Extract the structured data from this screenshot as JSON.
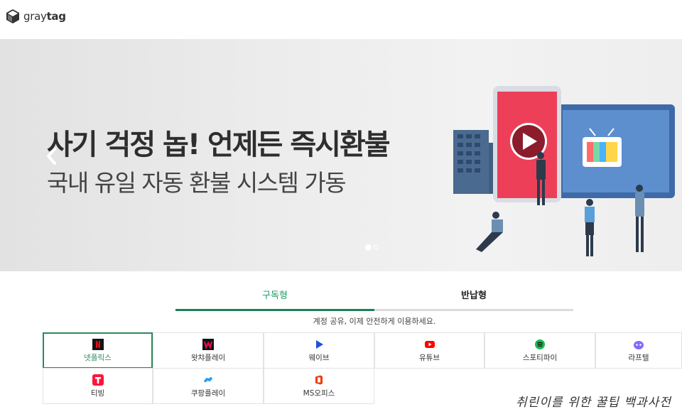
{
  "brand": {
    "logo_text_light": "gray",
    "logo_text_bold": "tag"
  },
  "banner": {
    "title": "사기 걱정 놉! 언제든 즉시환불",
    "subtitle": "국내 유일 자동 환불 시스템 가동",
    "slides_total": 2,
    "slide_active": 1
  },
  "tabs": [
    {
      "label": "구독형",
      "active": true
    },
    {
      "label": "반납형",
      "active": false
    }
  ],
  "notice": "계정 공유, 이제 안전하게 이용하세요.",
  "services": [
    {
      "name": "넷플릭스",
      "icon": "netflix-icon",
      "color": "#e50914",
      "active": true
    },
    {
      "name": "왓챠플레이",
      "icon": "watcha-icon",
      "color": "#ff0558",
      "active": false
    },
    {
      "name": "웨이브",
      "icon": "wavve-icon",
      "color": "#1f4fe0",
      "active": false
    },
    {
      "name": "유튜브",
      "icon": "youtube-icon",
      "color": "#ff0000",
      "active": false
    },
    {
      "name": "스포티파이",
      "icon": "spotify-icon",
      "color": "#1db954",
      "active": false
    },
    {
      "name": "라프텔",
      "icon": "laftel-icon",
      "color": "#816bff",
      "active": false
    },
    {
      "name": "티빙",
      "icon": "tving-icon",
      "color": "#ff153c",
      "active": false
    },
    {
      "name": "쿠팡플레이",
      "icon": "coupangplay-icon",
      "color": "#2f9df4",
      "active": false
    },
    {
      "name": "MS오피스",
      "icon": "msoffice-icon",
      "color": "#eb3c00",
      "active": false
    }
  ],
  "watermark": "취린이를 위한 꿀팁 백과사전",
  "colors": {
    "accent": "#1e7f55",
    "banner_bg": "#ececec"
  }
}
